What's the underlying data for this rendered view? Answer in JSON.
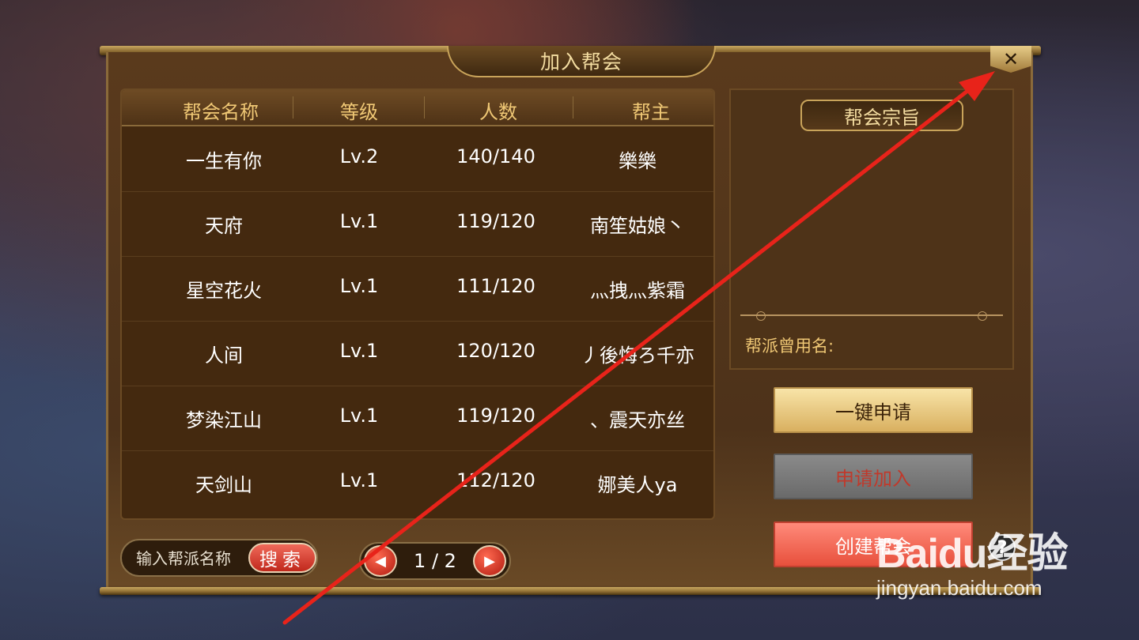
{
  "dialog": {
    "title": "加入帮会",
    "close_label": "✕"
  },
  "table": {
    "headers": [
      "帮会名称",
      "等级",
      "人数",
      "帮主"
    ],
    "rows": [
      [
        "一生有你",
        "Lv.2",
        "140/140",
        "樂樂"
      ],
      [
        "天府",
        "Lv.1",
        "119/120",
        "南笙姑娘丶"
      ],
      [
        "星空花火",
        "Lv.1",
        "111/120",
        "灬拽灬紫霜"
      ],
      [
        "人间",
        "Lv.1",
        "120/120",
        "丿後悔ろ千亦"
      ],
      [
        "梦染江山",
        "Lv.1",
        "119/120",
        "、震天亦丝"
      ],
      [
        "天剑山",
        "Lv.1",
        "112/120",
        "娜美人ya"
      ]
    ]
  },
  "side": {
    "purpose_title": "帮会宗旨",
    "former_name_label": "帮派曾用名:"
  },
  "buttons": {
    "one_click_apply": "一键申请",
    "apply_join": "申请加入",
    "create_guild": "创建帮会",
    "help": "?"
  },
  "search": {
    "placeholder": "输入帮派名称",
    "button": "搜索"
  },
  "pager": {
    "text": "1 / 2",
    "prev": "◀",
    "next": "▶"
  },
  "watermark": {
    "logo": "Baidu经验",
    "url": "jingyan.baidu.com"
  },
  "colors": {
    "annotation_arrow": "#e8231a",
    "gold_text": "#f0c875"
  }
}
